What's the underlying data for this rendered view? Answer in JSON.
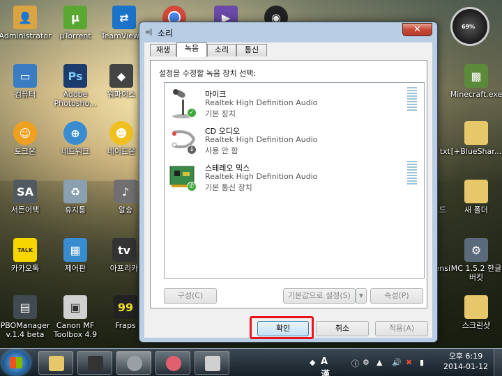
{
  "desktop": {
    "icons": [
      {
        "label": "Administrator",
        "color": "#d9a441",
        "glyph": "📁"
      },
      {
        "label": "μTorrent",
        "color": "#5aa832",
        "glyph": "μ"
      },
      {
        "label": "TeamViewer",
        "color": "#1a73c9",
        "glyph": "⇄"
      },
      {
        "label": "",
        "color": "#d44a3a",
        "glyph": "◉"
      },
      {
        "label": "",
        "color": "#6a4aa8",
        "glyph": "▶"
      },
      {
        "label": "",
        "color": "#222222",
        "glyph": "●"
      },
      {
        "label": "컴퓨터",
        "color": "#3a7cc2",
        "glyph": "▭"
      },
      {
        "label": "Adobe Photosho...",
        "color": "#1c3c6e",
        "glyph": "Ps"
      },
      {
        "label": "워파이스",
        "color": "#444444",
        "glyph": "◆"
      },
      {
        "label": "토크온",
        "color": "#f0a020",
        "glyph": "☺"
      },
      {
        "label": "네트워크",
        "color": "#3a8cd0",
        "glyph": "⊕"
      },
      {
        "label": "네이트온",
        "color": "#f0c020",
        "glyph": "☻"
      },
      {
        "label": "서든어택",
        "color": "#505a60",
        "glyph": "SA"
      },
      {
        "label": "휴지통",
        "color": "#8aa0b0",
        "glyph": "♻"
      },
      {
        "label": "알송",
        "color": "#707070",
        "glyph": "♪"
      },
      {
        "label": "카카오톡",
        "color": "#f7d600",
        "glyph": "TALK"
      },
      {
        "label": "제어판",
        "color": "#3a8cd0",
        "glyph": "▦"
      },
      {
        "label": "아프리카",
        "color": "#333333",
        "glyph": "tv"
      },
      {
        "label": "PBOManager v.1.4 beta",
        "color": "#404a50",
        "glyph": "▤"
      },
      {
        "label": "Canon MF Toolbox 4.9",
        "color": "#d0d0d0",
        "glyph": "▣"
      },
      {
        "label": "Fraps",
        "color": "#222222",
        "glyph": "99"
      },
      {
        "label": "Minecraft.exe",
        "color": "#5a8a3a",
        "glyph": "▩"
      },
      {
        "label": "txt",
        "color": "#eeeeee",
        "glyph": ""
      },
      {
        "label": "[+BlueShar...",
        "color": "#e6c86a",
        "glyph": "📁"
      },
      {
        "label": "드",
        "color": "#eeeeee",
        "glyph": ""
      },
      {
        "label": "새 폴더",
        "color": "#e6c86a",
        "glyph": "📁"
      },
      {
        "label": "ensi",
        "color": "#eeeeee",
        "glyph": ""
      },
      {
        "label": "MC 1.5.2 한글버킷",
        "color": "#5a6a7a",
        "glyph": "⚙"
      },
      {
        "label": "스크린샷",
        "color": "#e6c86a",
        "glyph": "📁"
      }
    ],
    "gadget_percent": "69%"
  },
  "dialog": {
    "title": "소리",
    "close_glyph": "✕",
    "tabs": [
      "재생",
      "녹음",
      "소리",
      "통신"
    ],
    "active_tab": "녹음",
    "instruction": "설정을 수정할 녹음 장치 선택:",
    "devices": [
      {
        "name": "마이크",
        "driver": "Realtek High Definition Audio",
        "status": "기본 장치",
        "badge": "✓",
        "badge_color": "#3aa83a",
        "has_meter": true,
        "icon": "microphone-icon"
      },
      {
        "name": "CD 오디오",
        "driver": "Realtek High Definition Audio",
        "status": "사용 안 함",
        "badge": "↓",
        "badge_color": "#606060",
        "has_meter": false,
        "icon": "cd-audio-icon"
      },
      {
        "name": "스테레오 믹스",
        "driver": "Realtek High Definition Audio",
        "status": "기본 통신 장치",
        "badge": "✆",
        "badge_color": "#3aa83a",
        "has_meter": true,
        "icon": "sound-card-icon"
      }
    ],
    "configure_label": "구성(C)",
    "set_default_label": "기본값으로 설정(S)",
    "properties_label": "속성(P)",
    "ok_label": "확인",
    "cancel_label": "취소",
    "apply_label": "적용(A)"
  },
  "taskbar": {
    "tray_text": "A 漢",
    "clock_time": "오후 6:19",
    "clock_date": "2014-01-12"
  }
}
